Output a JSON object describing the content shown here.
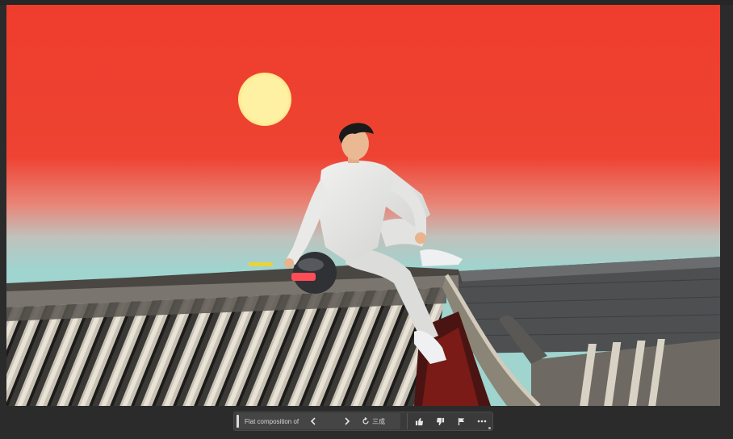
{
  "generation_toolbar": {
    "prompt_text": "Flat composition of",
    "previous_icon": "chevron-left-icon",
    "next_icon": "chevron-right-icon",
    "regenerate_label": "三成",
    "regenerate_icon": "refresh-icon",
    "like_icon": "thumbs-up-icon",
    "dislike_icon": "thumbs-down-icon",
    "report_icon": "flag-icon",
    "more_icon": "more-horizontal-icon"
  },
  "canvas": {
    "description_elements": [
      "red-sky",
      "sun",
      "person",
      "helmet",
      "temple-roof"
    ]
  },
  "colors": {
    "sky_top": "#ef3d2d",
    "sky_bottom": "#9fd4cf",
    "sun": "#fff1a3",
    "toolbar_bg": "#3a3a3a"
  }
}
